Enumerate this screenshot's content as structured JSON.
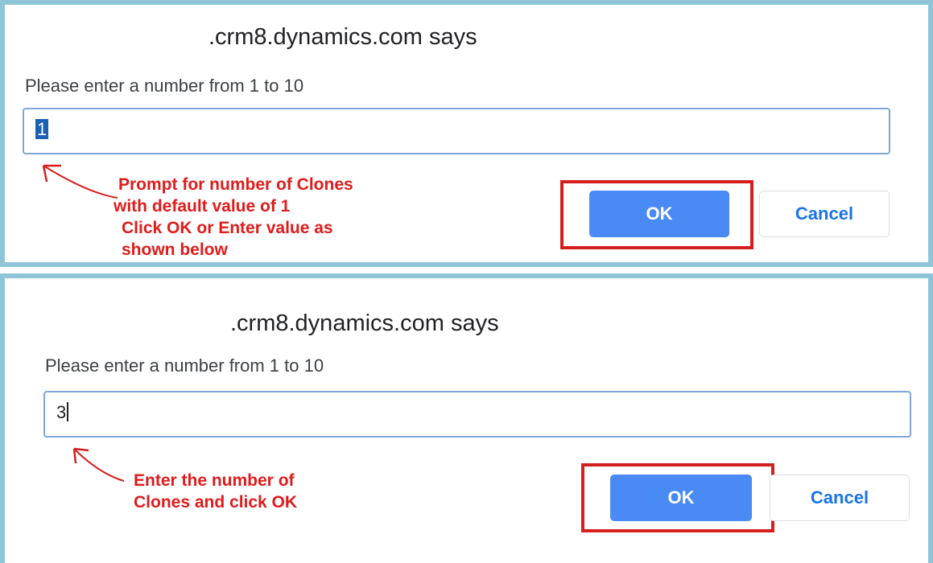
{
  "dialogs": [
    {
      "title": ".crm8.dynamics.com says",
      "message": "Please enter a number from 1 to 10",
      "input_value": "1",
      "ok_label": "OK",
      "cancel_label": "Cancel",
      "annotation": [
        "Prompt for number of Clones",
        "with default value of 1",
        "Click OK or Enter value as",
        "shown below"
      ]
    },
    {
      "title": ".crm8.dynamics.com says",
      "message": "Please enter a number from 1 to 10",
      "input_value": "3",
      "ok_label": "OK",
      "cancel_label": "Cancel",
      "annotation": [
        "Enter the number of",
        "Clones and click OK"
      ]
    }
  ],
  "colors": {
    "panel_border": "#8fc5d8",
    "annotation_red": "#e01b1b",
    "ok_blue": "#4a8af4",
    "cancel_text_blue": "#1a73e8",
    "selection_blue": "#1a5fb4"
  }
}
